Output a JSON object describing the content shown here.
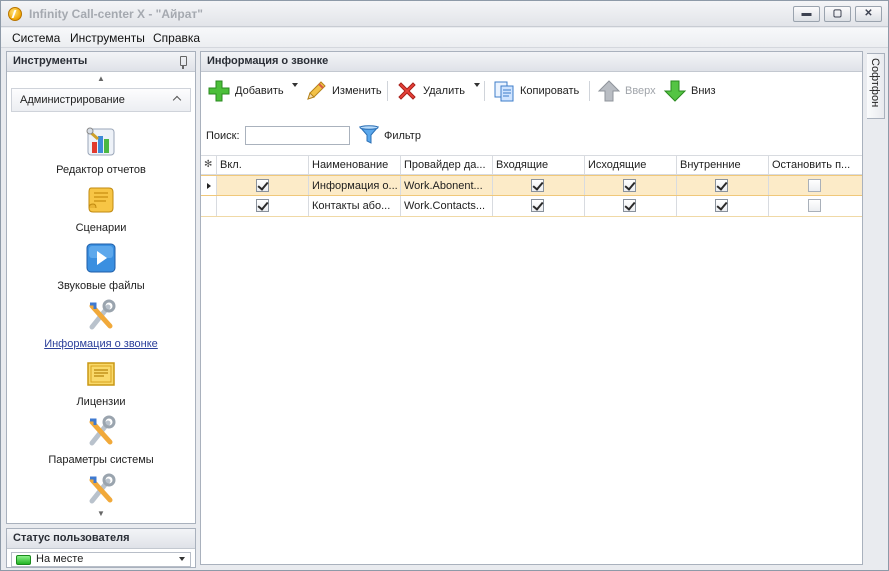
{
  "window": {
    "title": "Infinity Call-center X - \"Айрат\"",
    "buttons": {
      "minimize": "▬",
      "maximize": "▢",
      "close": "✕"
    }
  },
  "menu": [
    "Система",
    "Инструменты",
    "Справка"
  ],
  "left_panel": {
    "title": "Инструменты",
    "group": "Администрирование",
    "tools": [
      {
        "label": "Редактор отчетов",
        "icon": "report-editor-icon"
      },
      {
        "label": "Сценарии",
        "icon": "scroll-icon"
      },
      {
        "label": "Звуковые файлы",
        "icon": "play-icon"
      },
      {
        "label": "Информация о звонке",
        "icon": "tools-icon",
        "active": true
      },
      {
        "label": "Лицензии",
        "icon": "license-icon"
      },
      {
        "label": "Параметры системы",
        "icon": "tools-icon"
      }
    ]
  },
  "status_panel": {
    "title": "Статус пользователя",
    "value": "На месте",
    "color": "#23b424"
  },
  "main_panel": {
    "title": "Информация о звонке",
    "toolbar": {
      "add": "Добавить",
      "edit": "Изменить",
      "delete": "Удалить",
      "copy": "Копировать",
      "up": "Вверх",
      "down": "Вниз"
    },
    "search": {
      "label": "Поиск:",
      "value": "",
      "filter": "Фильтр"
    },
    "grid": {
      "columns": [
        "Вкл.",
        "Наименование",
        "Провайдер да...",
        "Входящие",
        "Исходящие",
        "Внутренние",
        "Остановить п..."
      ],
      "rows": [
        {
          "name": "Информация о...",
          "provider": "Work.Abonent...",
          "enabled": true,
          "incoming": true,
          "outgoing": true,
          "internal": true,
          "stop": false
        },
        {
          "name": "Контакты або...",
          "provider": "Work.Contacts...",
          "enabled": true,
          "incoming": true,
          "outgoing": true,
          "internal": true,
          "stop": false
        }
      ]
    }
  },
  "right_tab": {
    "label": "Софтфон"
  }
}
